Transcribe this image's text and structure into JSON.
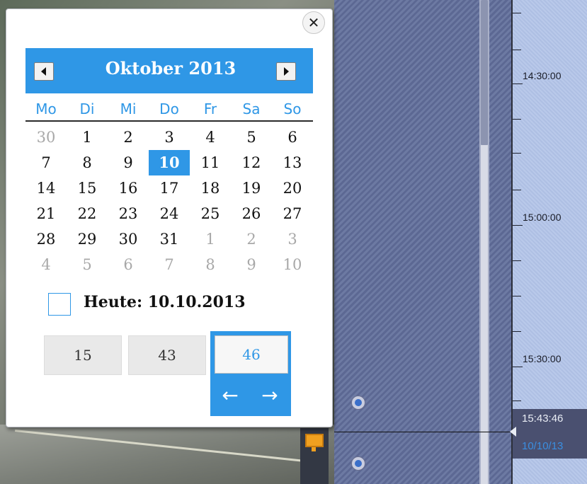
{
  "calendar": {
    "month_title": "Oktober 2013",
    "weekdays": [
      "Mo",
      "Di",
      "Mi",
      "Do",
      "Fr",
      "Sa",
      "So"
    ],
    "weeks": [
      [
        "30",
        "1",
        "2",
        "3",
        "4",
        "5",
        "6"
      ],
      [
        "7",
        "8",
        "9",
        "10",
        "11",
        "12",
        "13"
      ],
      [
        "14",
        "15",
        "16",
        "17",
        "18",
        "19",
        "20"
      ],
      [
        "21",
        "22",
        "23",
        "24",
        "25",
        "26",
        "27"
      ],
      [
        "28",
        "29",
        "30",
        "31",
        "1",
        "2",
        "3"
      ],
      [
        "4",
        "5",
        "6",
        "7",
        "8",
        "9",
        "10"
      ]
    ],
    "selected_day": "10",
    "today_label": "Heute: 10.10.2013",
    "close_symbol": "✕"
  },
  "time_picker": {
    "hours": "15",
    "minutes": "43",
    "seconds": "46",
    "arrow_left": "←",
    "arrow_right": "→"
  },
  "timeline": {
    "labels": [
      "14:30:00",
      "15:00:00",
      "15:30:00"
    ],
    "cursor_time": "15:43:46",
    "cursor_date": "10/10/13"
  },
  "colors": {
    "accent": "#2f97e6",
    "other_month_text": "#a8a8a8"
  },
  "icons": [
    "close-icon",
    "prev-month-icon",
    "next-month-icon",
    "arrow-left-icon",
    "arrow-right-icon",
    "monitor-icon"
  ]
}
